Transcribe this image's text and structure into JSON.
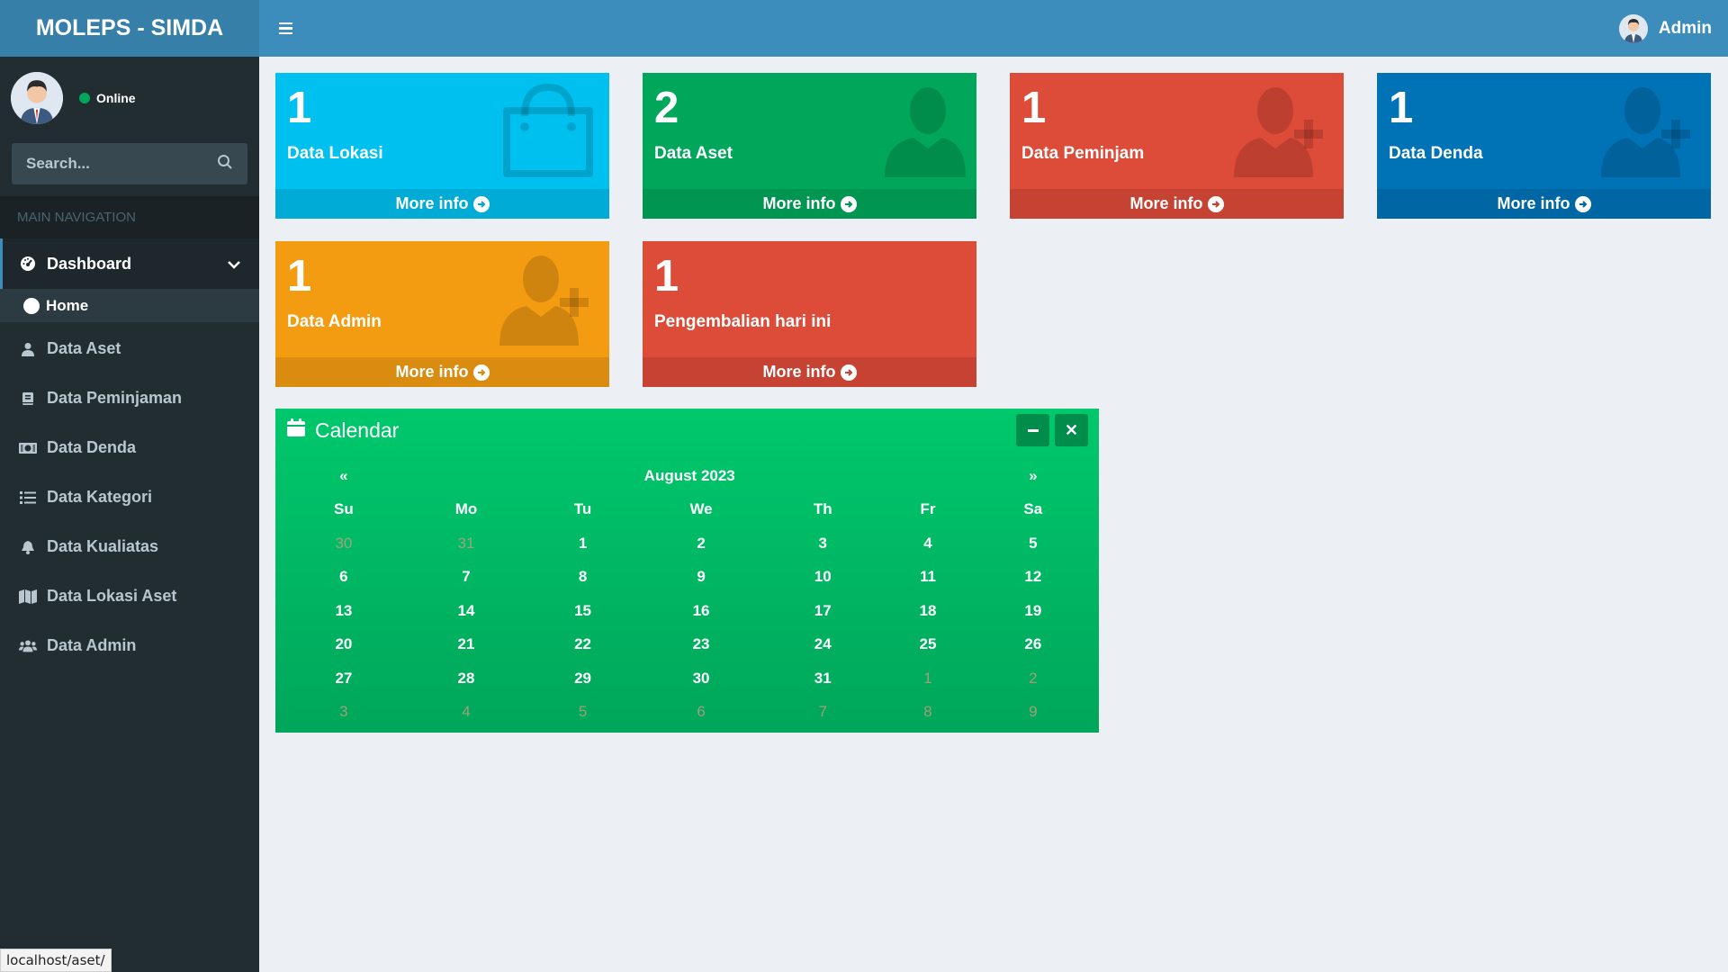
{
  "brand": "MOLEPS - SIMDA",
  "header": {
    "user_name": "Admin"
  },
  "sidebar": {
    "status": "Online",
    "search_placeholder": "Search...",
    "nav_header": "MAIN NAVIGATION",
    "dashboard": "Dashboard",
    "home": "Home",
    "items": [
      {
        "label": "Data Aset",
        "icon": "user-icon"
      },
      {
        "label": "Data Peminjaman",
        "icon": "book-icon"
      },
      {
        "label": "Data Denda",
        "icon": "money-icon"
      },
      {
        "label": "Data Kategori",
        "icon": "list-icon"
      },
      {
        "label": "Data Kualiatas",
        "icon": "bell-icon"
      },
      {
        "label": "Data Lokasi Aset",
        "icon": "map-icon"
      },
      {
        "label": "Data Admin",
        "icon": "users-icon"
      }
    ]
  },
  "boxes": [
    {
      "number": "1",
      "label": "Data Lokasi",
      "more": "More info",
      "color": "#00c0ef",
      "icon": "shopping-bag-icon"
    },
    {
      "number": "2",
      "label": "Data Aset",
      "more": "More info",
      "color": "#00a65a",
      "icon": "person-icon"
    },
    {
      "number": "1",
      "label": "Data Peminjam",
      "more": "More info",
      "color": "#dd4b39",
      "icon": "user-plus-icon"
    },
    {
      "number": "1",
      "label": "Data Denda",
      "more": "More info",
      "color": "#0073b7",
      "icon": "user-plus-icon"
    },
    {
      "number": "1",
      "label": "Data Admin",
      "more": "More info",
      "color": "#f39c12",
      "icon": "user-plus-icon"
    },
    {
      "number": "1",
      "label": "Pengembalian hari ini",
      "more": "More info",
      "color": "#dd4b39",
      "icon": ""
    }
  ],
  "calendar": {
    "title": "Calendar",
    "month": "August 2023",
    "prev": "«",
    "next": "»",
    "weekdays": [
      "Su",
      "Mo",
      "Tu",
      "We",
      "Th",
      "Fr",
      "Sa"
    ],
    "weeks": [
      [
        "30",
        "31",
        "1",
        "2",
        "3",
        "4",
        "5"
      ],
      [
        "6",
        "7",
        "8",
        "9",
        "10",
        "11",
        "12"
      ],
      [
        "13",
        "14",
        "15",
        "16",
        "17",
        "18",
        "19"
      ],
      [
        "20",
        "21",
        "22",
        "23",
        "24",
        "25",
        "26"
      ],
      [
        "27",
        "28",
        "29",
        "30",
        "31",
        "1",
        "2"
      ],
      [
        "3",
        "4",
        "5",
        "6",
        "7",
        "8",
        "9"
      ]
    ]
  },
  "status_bar": "localhost/aset/"
}
